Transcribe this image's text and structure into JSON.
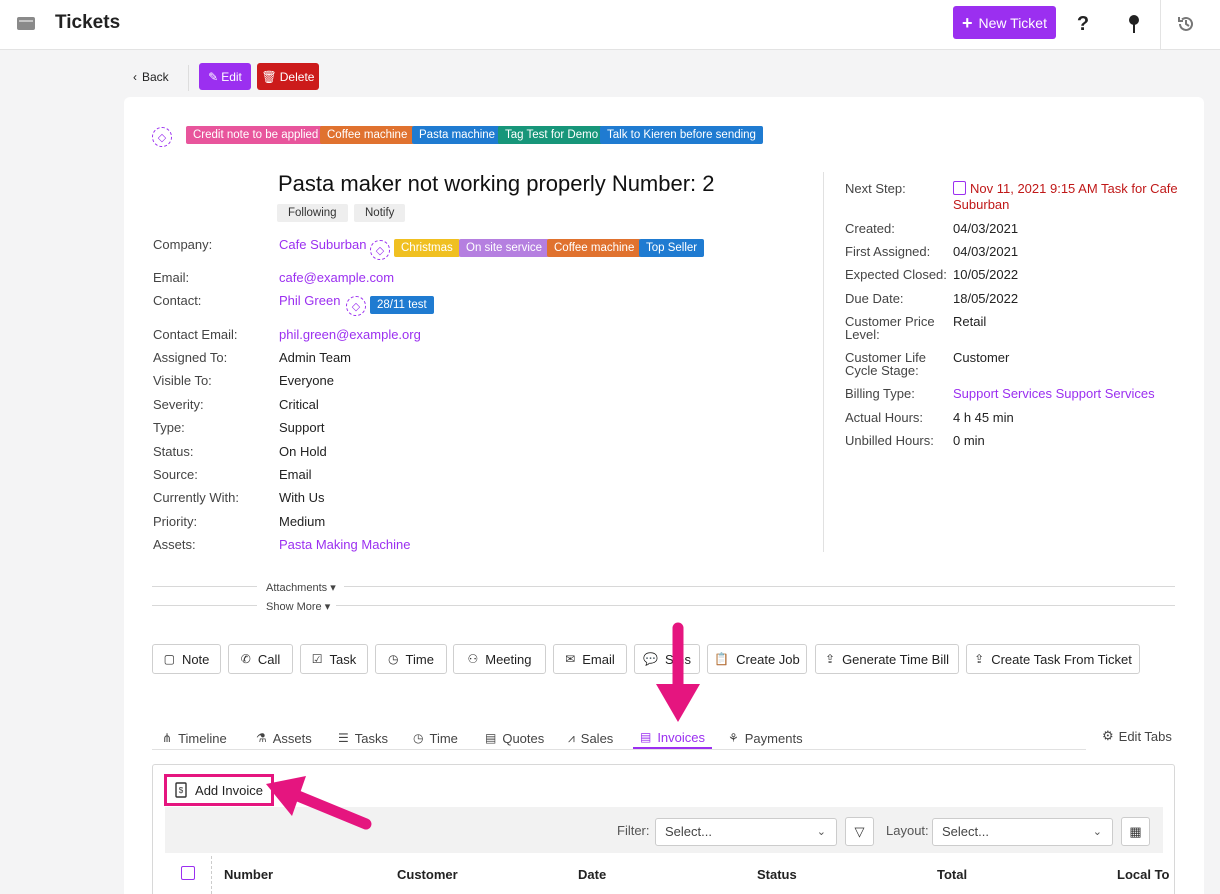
{
  "topbar": {
    "title": "Tickets",
    "new_ticket_label": "New Ticket",
    "icons": [
      "ticket-icon",
      "help-icon",
      "pin-icon",
      "history-icon"
    ]
  },
  "actions": {
    "back_label": "Back",
    "edit_label": "Edit",
    "delete_label": "Delete"
  },
  "ticket_tags": [
    {
      "label": "Credit note to be applied",
      "color": "#e8559c"
    },
    {
      "label": "Coffee machine",
      "color": "#e0722f"
    },
    {
      "label": "Pasta machine",
      "color": "#1f7bd1"
    },
    {
      "label": "Tag Test for Demo",
      "color": "#17967a"
    },
    {
      "label": "Talk to Kieren before sending",
      "color": "#1f7bd1"
    }
  ],
  "ticket": {
    "title": "Pasta maker not working properly Number: 2",
    "following_label": "Following",
    "notify_label": "Notify"
  },
  "fields": {
    "company": {
      "label": "Company:",
      "value": "Cafe Suburban"
    },
    "company_tags": [
      {
        "label": "Christmas",
        "color": "#f0c021"
      },
      {
        "label": "On site service",
        "color": "#b57fe0"
      },
      {
        "label": "Coffee machine",
        "color": "#e0722f"
      },
      {
        "label": "Top Seller",
        "color": "#1f7bd1"
      }
    ],
    "email": {
      "label": "Email:",
      "value": "cafe@example.com"
    },
    "contact": {
      "label": "Contact:",
      "value": "Phil Green"
    },
    "contact_tags": [
      {
        "label": "28/11 test",
        "color": "#1f7bd1"
      }
    ],
    "contact_email": {
      "label": "Contact Email:",
      "value": "phil.green@example.org"
    },
    "assigned_to": {
      "label": "Assigned To:",
      "value": "Admin Team"
    },
    "visible_to": {
      "label": "Visible To:",
      "value": "Everyone"
    },
    "severity": {
      "label": "Severity:",
      "value": "Critical"
    },
    "type": {
      "label": "Type:",
      "value": "Support"
    },
    "status": {
      "label": "Status:",
      "value": "On Hold"
    },
    "source": {
      "label": "Source:",
      "value": "Email"
    },
    "currently_with": {
      "label": "Currently With:",
      "value": "With Us"
    },
    "priority": {
      "label": "Priority:",
      "value": "Medium"
    },
    "assets": {
      "label": "Assets:",
      "value": "Pasta Making Machine"
    }
  },
  "right": {
    "next_step": {
      "label": "Next Step:",
      "value": "Nov 11, 2021 9:15 AM Task for Cafe Suburban"
    },
    "created": {
      "label": "Created:",
      "value": "04/03/2021"
    },
    "first_assigned": {
      "label": "First Assigned:",
      "value": "04/03/2021"
    },
    "expected_closed": {
      "label": "Expected Closed:",
      "value": "10/05/2022"
    },
    "due_date": {
      "label": "Due Date:",
      "value": "18/05/2022"
    },
    "customer_price_level": {
      "label": "Customer Price Level:",
      "value": "Retail"
    },
    "customer_life_cycle": {
      "label": "Customer Life Cycle Stage:",
      "value": "Customer"
    },
    "billing_type": {
      "label": "Billing Type:",
      "value": "Support Services Support Services"
    },
    "actual_hours": {
      "label": "Actual Hours:",
      "value": "4 h 45 min"
    },
    "unbilled_hours": {
      "label": "Unbilled Hours:",
      "value": "0 min"
    }
  },
  "sections": {
    "attachments_label": "Attachments",
    "show_more_label": "Show More"
  },
  "activity_buttons": [
    "Note",
    "Call",
    "Task",
    "Time",
    "Meeting",
    "Email",
    "Sms",
    "Create Job",
    "Generate Time Bill",
    "Create Task From Ticket"
  ],
  "tabs": [
    "Timeline",
    "Assets",
    "Tasks",
    "Time",
    "Quotes",
    "Sales",
    "Invoices",
    "Payments"
  ],
  "active_tab": "Invoices",
  "edit_tabs_label": "Edit Tabs",
  "invoices": {
    "add_label": "Add Invoice",
    "filter_label": "Filter:",
    "filter_placeholder": "Select...",
    "layout_label": "Layout:",
    "layout_placeholder": "Select...",
    "columns": [
      "Number",
      "Customer",
      "Date",
      "Status",
      "Total",
      "Local To"
    ]
  },
  "colors": {
    "accent": "#9b2ff0",
    "delete": "#cc1b1b",
    "highlight": "#e5157f",
    "next_step": "#c01818"
  }
}
